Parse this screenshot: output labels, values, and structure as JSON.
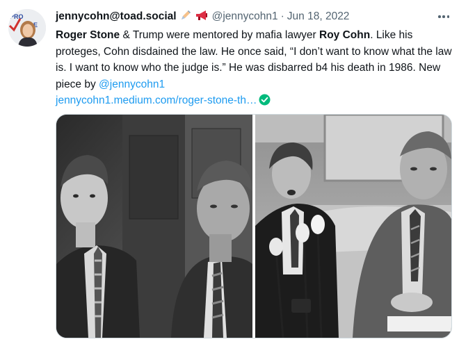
{
  "tweet": {
    "display_name": "jennycohn@toad.social",
    "emoji_icons": [
      "pen-icon",
      "megaphone-icon"
    ],
    "handle": "@jennycohn1",
    "separator": "·",
    "date": "Jun 18, 2022",
    "text": {
      "name_1": "Roger Stone",
      "part_1": " & Trump were mentored by mafia lawyer ",
      "name_2": "Roy Cohn",
      "part_2": ". Like his proteges, Cohn disdained the law. He once said, “I don’t want to know what the law is. I want to know who the judge is.” He was disbarred b4 his death in 1986. New piece by ",
      "mention": "@jennycohn1",
      "link": "jennycohn1.medium.com/roger-stone-th…"
    },
    "media": [
      {
        "kind": "black-and-white photo",
        "position": "left"
      },
      {
        "kind": "black-and-white photo",
        "position": "right"
      }
    ]
  },
  "colors": {
    "text": "#0f1419",
    "secondary": "#536471",
    "link": "#1d9bf0",
    "verified": "#00ba7c",
    "border": "#cfd9de"
  }
}
